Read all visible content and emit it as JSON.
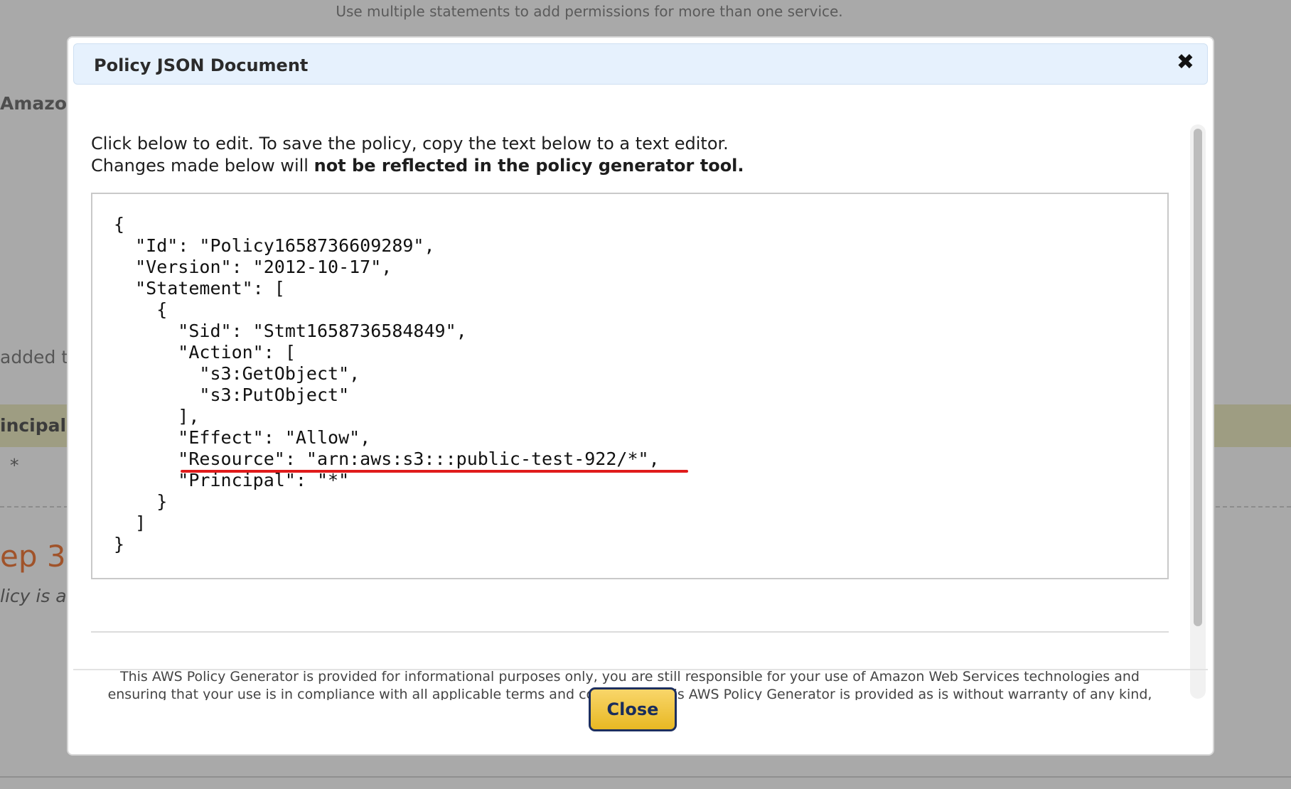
{
  "background": {
    "hint": "Use multiple statements to add permissions for more than one service.",
    "amazon": "Amazon",
    "added": "added t",
    "principal": "incipal",
    "star": "*",
    "step": "ep 3:",
    "policy": "licy is a"
  },
  "modal": {
    "title": "Policy JSON Document",
    "close_icon": "✖",
    "instructions_line1": "Click below to edit. To save the policy, copy the text below to a text editor.",
    "instructions_line2_normal": "Changes made below will ",
    "instructions_line2_bold": "not be reflected in the policy generator tool.",
    "json_text": "{\n  \"Id\": \"Policy1658736609289\",\n  \"Version\": \"2012-10-17\",\n  \"Statement\": [\n    {\n      \"Sid\": \"Stmt1658736584849\",\n      \"Action\": [\n        \"s3:GetObject\",\n        \"s3:PutObject\"\n      ],\n      \"Effect\": \"Allow\",\n      \"Resource\": \"arn:aws:s3:::public-test-922/*\",\n      \"Principal\": \"*\"\n    }\n  ]\n}",
    "disclaimer": "This AWS Policy Generator is provided for informational purposes only, you are still responsible for your use of Amazon Web Services technologies and ensuring that your use is in compliance with all applicable terms and conditions. This AWS Policy Generator is provided as is without warranty of any kind, whether express, implied, or",
    "close_button": "Close"
  },
  "colors": {
    "header_bg": "#e6f1fd",
    "button_bg": "#f4c84a",
    "button_border": "#1d2f5f",
    "underline": "#e01b1b"
  }
}
